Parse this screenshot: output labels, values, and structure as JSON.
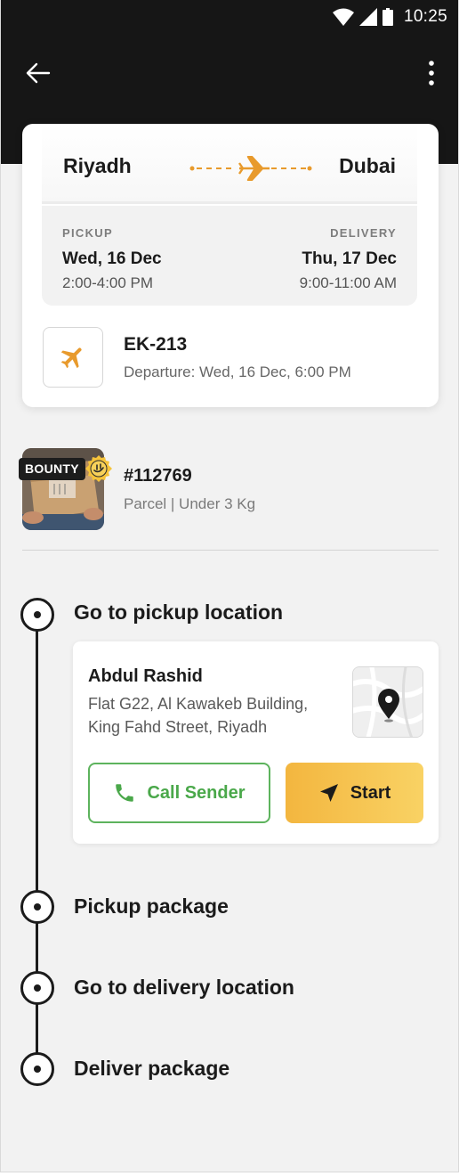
{
  "status_bar": {
    "time": "10:25"
  },
  "route": {
    "from_city": "Riyadh",
    "to_city": "Dubai",
    "pickup_label": "PICKUP",
    "pickup_date": "Wed, 16 Dec",
    "pickup_time": "2:00-4:00 PM",
    "delivery_label": "DELIVERY",
    "delivery_date": "Thu, 17 Dec",
    "delivery_time": "9:00-11:00 AM",
    "accent_color": "#E89A2C"
  },
  "flight": {
    "number": "EK-213",
    "departure": "Departure: Wed, 16 Dec, 6:00 PM",
    "icon": "plane-icon"
  },
  "parcel": {
    "badge": "BOUNTY",
    "id": "#112769",
    "description": "Parcel | Under 3 Kg"
  },
  "steps": [
    {
      "title": "Go to pickup location"
    },
    {
      "title": "Pickup package"
    },
    {
      "title": "Go to delivery location"
    },
    {
      "title": "Deliver package"
    }
  ],
  "pickup": {
    "sender_name": "Abdul Rashid",
    "address_line1": "Flat G22, Al Kawakeb Building,",
    "address_line2": "King Fahd Street, Riyadh",
    "call_label": "Call Sender",
    "start_label": "Start",
    "call_color": "#4AA84A",
    "start_color": "#F5C04A"
  }
}
